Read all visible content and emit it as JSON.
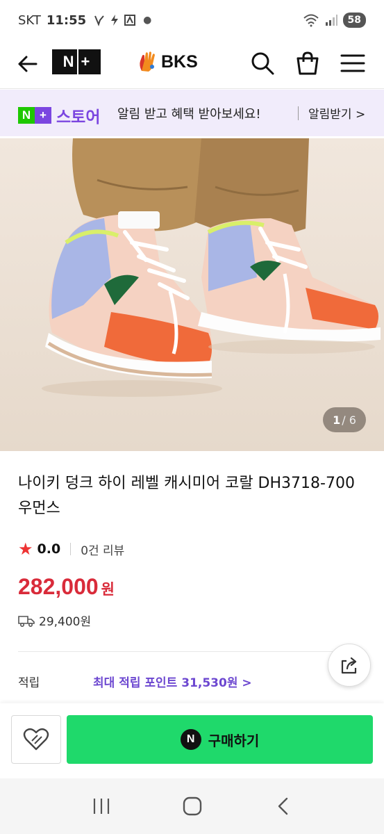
{
  "status_bar": {
    "carrier": "SKT",
    "time": "11:55",
    "battery": "58"
  },
  "header": {
    "nplus_logo_n": "N",
    "nplus_logo_plus": "+",
    "brand_name": "BKS"
  },
  "store_banner": {
    "logo_n": "N",
    "logo_plus": "+",
    "store_label": "스토어",
    "message": "알림 받고 혜택 받아보세요!",
    "notify_label": "알림받기 >"
  },
  "gallery": {
    "current": "1",
    "total": "/ 6"
  },
  "product": {
    "title": "나이키 덩크 하이 레벨 캐시미어 코랄 DH3718-700 우먼스",
    "rating": "0.0",
    "review_count": "0건 리뷰",
    "price": "282,000",
    "price_unit": "원",
    "shipping_fee": "29,400원",
    "points_label": "적립",
    "points_value": "최대 적립 포인트 31,530원 >"
  },
  "actions": {
    "buy_badge": "N",
    "buy_label": "구매하기"
  },
  "colors": {
    "accent_purple": "#7b46e0",
    "naver_green": "#1ec800",
    "buy_green": "#1fd96b",
    "price_red": "#d92b3a"
  }
}
